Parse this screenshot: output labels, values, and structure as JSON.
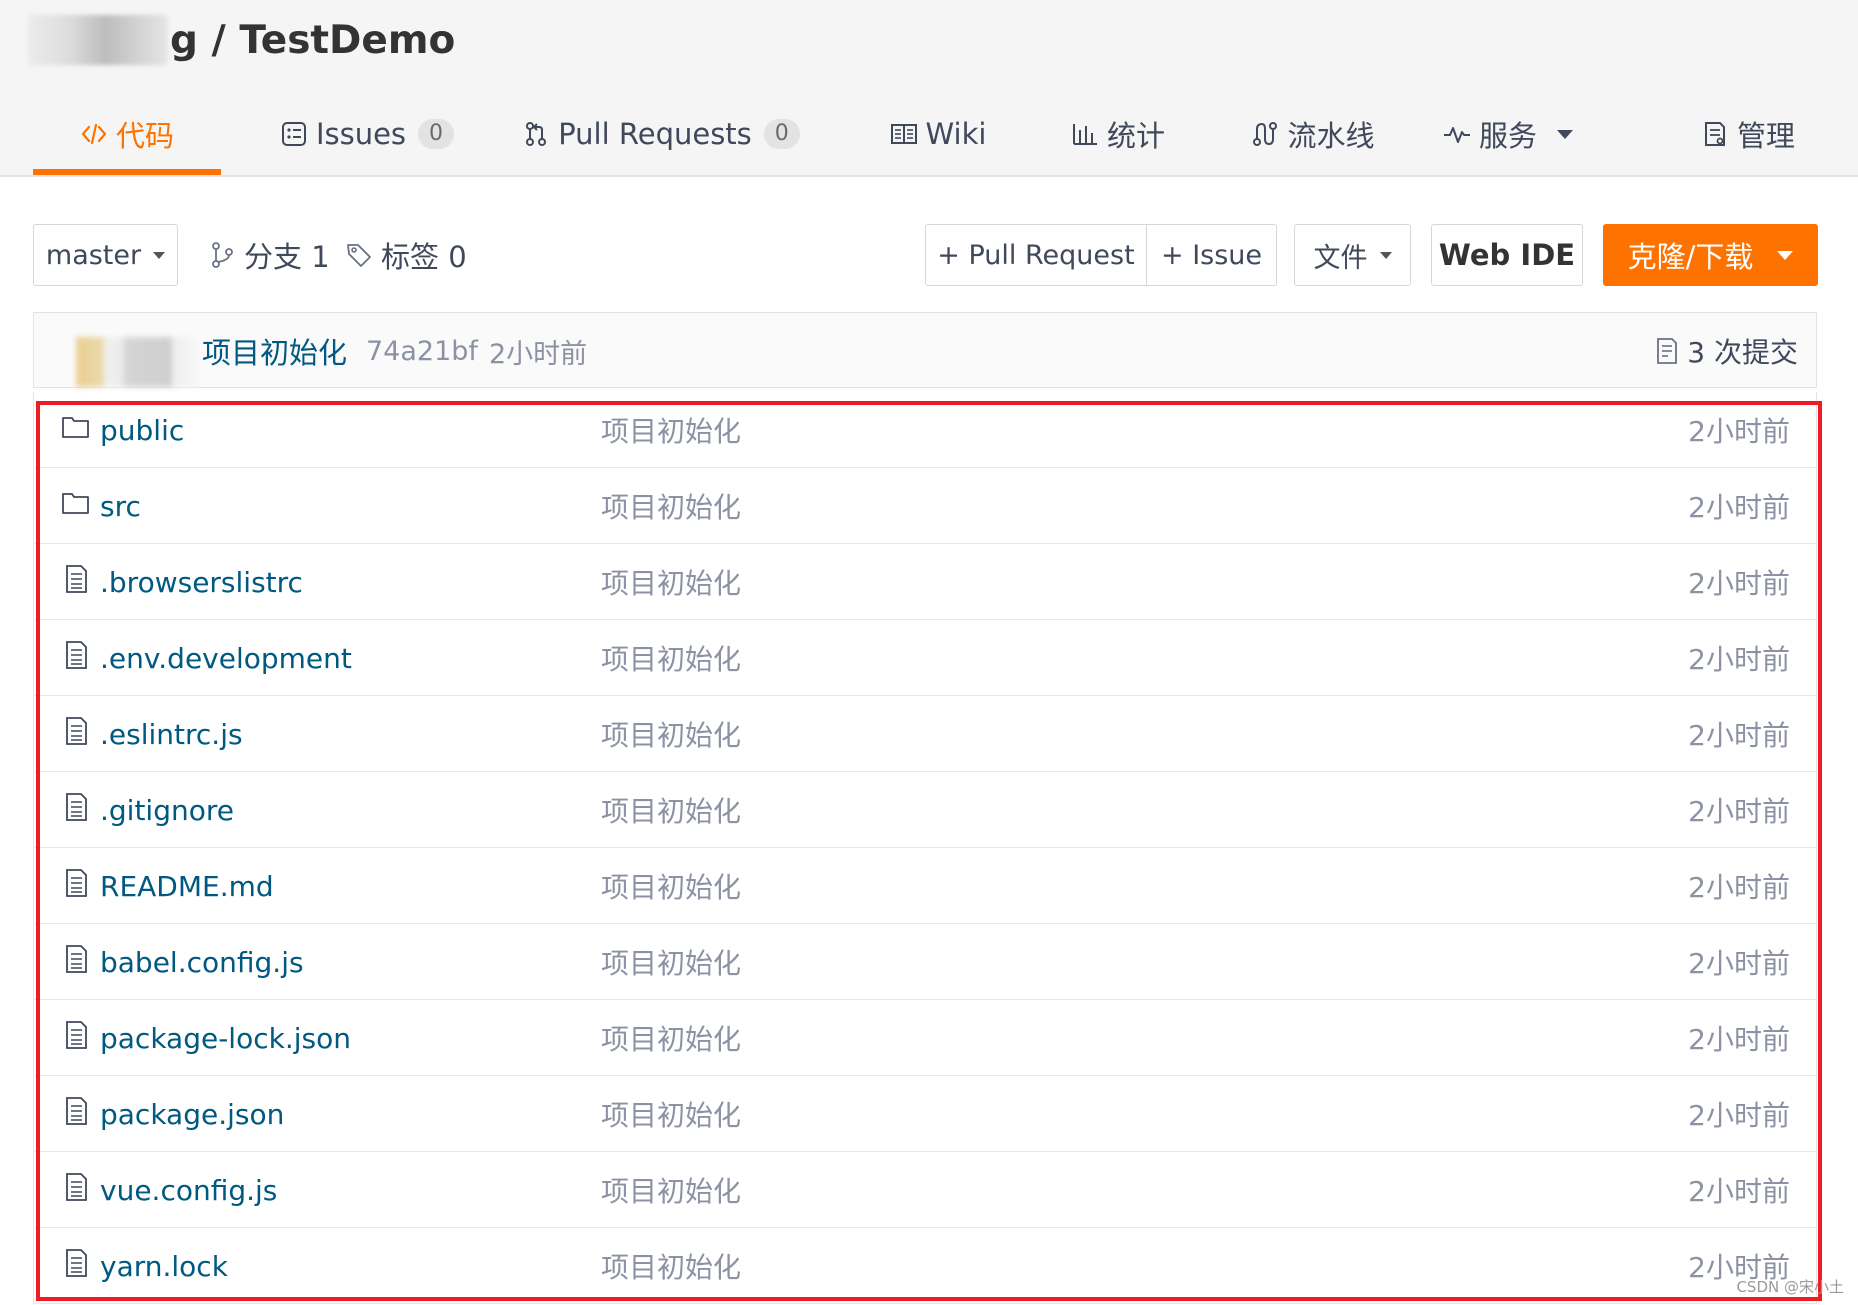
{
  "repo": {
    "owner_suffix": "g",
    "separator": " / ",
    "name": "TestDemo"
  },
  "tabs": [
    {
      "label": "代码",
      "icon": "code-icon",
      "active": true
    },
    {
      "label": "Issues",
      "count": "0",
      "icon": "issues-icon"
    },
    {
      "label": "Pull Requests",
      "count": "0",
      "icon": "pull-request-icon"
    },
    {
      "label": "Wiki",
      "icon": "wiki-book-icon"
    },
    {
      "label": "统计",
      "icon": "stats-bar-chart-icon"
    },
    {
      "label": "流水线",
      "icon": "pipeline-icon"
    },
    {
      "label": "服务",
      "icon": "pulse-service-icon",
      "has_dropdown": true
    },
    {
      "label": "管理",
      "icon": "manage-document-icon"
    }
  ],
  "toolbar": {
    "branch_select": "master",
    "branches": "分支 1",
    "tags": "标签 0",
    "new_pull_request": "+ Pull Request",
    "new_issue": "+ Issue",
    "file_menu": "文件",
    "web_ide": "Web IDE",
    "clone": "克隆/下载"
  },
  "commit": {
    "message": "项目初始化",
    "sha": "74a21bf",
    "time": "2小时前",
    "commit_count": "3 次提交"
  },
  "files": [
    {
      "name": "public",
      "type": "folder",
      "message": "项目初始化",
      "time": "2小时前"
    },
    {
      "name": "src",
      "type": "folder",
      "message": "项目初始化",
      "time": "2小时前"
    },
    {
      "name": ".browserslistrc",
      "type": "file",
      "message": "项目初始化",
      "time": "2小时前"
    },
    {
      "name": ".env.development",
      "type": "file",
      "message": "项目初始化",
      "time": "2小时前"
    },
    {
      "name": ".eslintrc.js",
      "type": "file",
      "message": "项目初始化",
      "time": "2小时前"
    },
    {
      "name": ".gitignore",
      "type": "file",
      "message": "项目初始化",
      "time": "2小时前"
    },
    {
      "name": "README.md",
      "type": "file",
      "message": "项目初始化",
      "time": "2小时前"
    },
    {
      "name": "babel.config.js",
      "type": "file",
      "message": "项目初始化",
      "time": "2小时前"
    },
    {
      "name": "package-lock.json",
      "type": "file",
      "message": "项目初始化",
      "time": "2小时前"
    },
    {
      "name": "package.json",
      "type": "file",
      "message": "项目初始化",
      "time": "2小时前"
    },
    {
      "name": "vue.config.js",
      "type": "file",
      "message": "项目初始化",
      "time": "2小时前"
    },
    {
      "name": "yarn.lock",
      "type": "file",
      "message": "项目初始化",
      "time": "2小时前"
    }
  ],
  "watermark": "CSDN @宋小土",
  "colors": {
    "accent": "#fe7300",
    "link": "#005980",
    "muted": "#8c92a4",
    "highlight": "#ee1d23"
  }
}
